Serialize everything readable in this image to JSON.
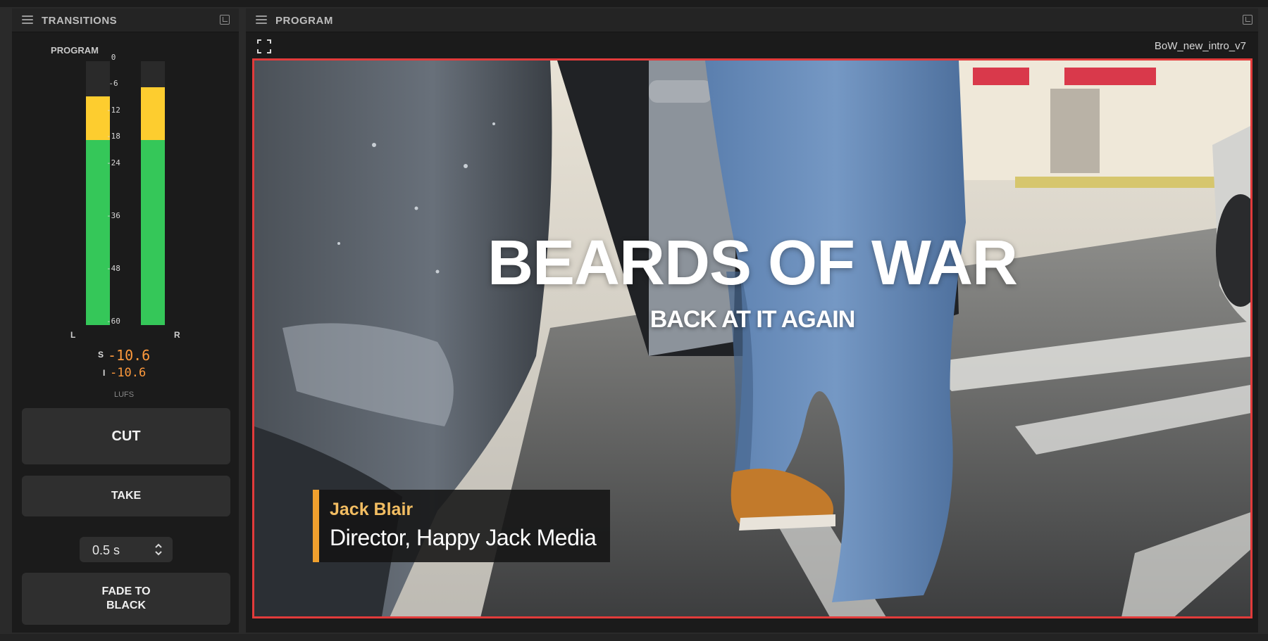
{
  "transitions_panel": {
    "title": "TRANSITIONS",
    "meter": {
      "label": "PROGRAM",
      "scale": [
        "0",
        "-6",
        "-12",
        "-18",
        "-24",
        "-36",
        "-48",
        "-60"
      ],
      "left_channel_label": "L",
      "right_channel_label": "R",
      "left_level_db": -8,
      "right_level_db": -6,
      "yellow_threshold_db": -18
    },
    "loudness": {
      "short_term_key": "S",
      "short_term_value": "-10.6",
      "integrated_key": "I",
      "integrated_value": "-10.6",
      "unit": "LUFS"
    },
    "cut_label": "CUT",
    "take_label": "TAKE",
    "duration_value": "0.5 s",
    "fade_label_line1": "FADE TO",
    "fade_label_line2": "BLACK"
  },
  "program_panel": {
    "title": "PROGRAM",
    "source_name": "BoW_new_intro_v7",
    "title_main": "BEARDS OF WAR",
    "title_sub": "BACK AT IT AGAIN",
    "lower_third_name": "Jack Blair",
    "lower_third_role": "Director, Happy Jack Media"
  },
  "colors": {
    "tally_red": "#e23b3b",
    "meter_green": "#35c759",
    "meter_yellow": "#fdcd2f",
    "lufs_orange": "#ff9a3c",
    "lower_third_accent": "#f0a02e"
  }
}
